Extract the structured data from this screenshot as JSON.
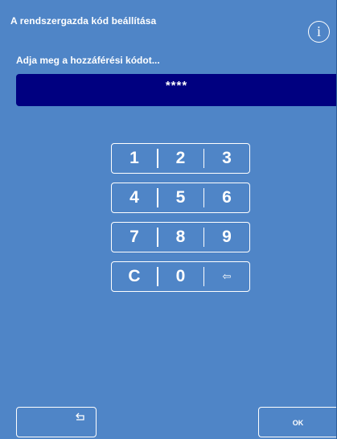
{
  "header": {
    "title": "A rendszergazda kód beállítása",
    "info_icon": "info-icon",
    "info_glyph": "i"
  },
  "prompt": {
    "label": "Adja meg a hozzáférési kódot..."
  },
  "code_field": {
    "value": "****",
    "background": "#000080"
  },
  "keypad": {
    "rows": [
      [
        "1",
        "2",
        "3"
      ],
      [
        "4",
        "5",
        "6"
      ],
      [
        "7",
        "8",
        "9"
      ],
      [
        "C",
        "0",
        "⇦"
      ]
    ],
    "backspace_icon": "backspace-arrow-icon"
  },
  "footer": {
    "back_icon": "return-arrow-icon",
    "ok_label": "OK"
  },
  "colors": {
    "screen_background": "#4f85c7",
    "text": "#ffffff"
  }
}
